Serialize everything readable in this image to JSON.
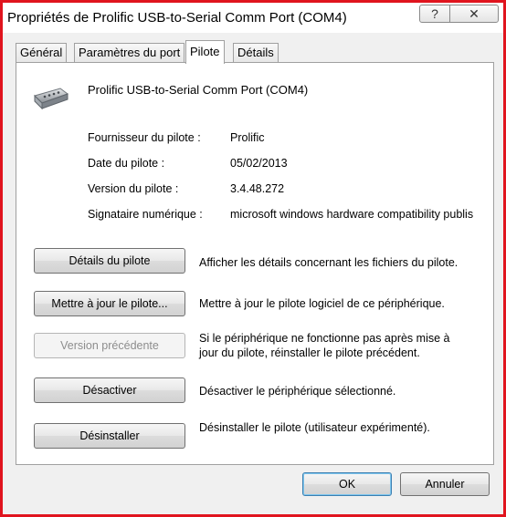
{
  "window": {
    "title": "Propriétés de Prolific USB-to-Serial Comm Port (COM4)",
    "help_label": "?",
    "close_label": "✕"
  },
  "tabs": [
    {
      "label": "Général"
    },
    {
      "label": "Paramètres du port"
    },
    {
      "label": "Pilote",
      "active": true
    },
    {
      "label": "Détails"
    }
  ],
  "device": {
    "icon": "serial-port-icon",
    "name": "Prolific USB-to-Serial Comm Port (COM4)"
  },
  "driver_info": [
    {
      "label": "Fournisseur du pilote :",
      "value": "Prolific"
    },
    {
      "label": "Date du pilote :",
      "value": "05/02/2013"
    },
    {
      "label": "Version du pilote :",
      "value": "3.4.48.272"
    },
    {
      "label": "Signataire numérique :",
      "value": "microsoft windows hardware compatibility publis"
    }
  ],
  "actions": [
    {
      "label": "Détails du pilote",
      "desc": [
        "Afficher les détails concernant les fichiers du pilote."
      ],
      "enabled": true
    },
    {
      "label": "Mettre à jour le pilote...",
      "desc": [
        "Mettre à jour le pilote logiciel de ce périphérique."
      ],
      "enabled": true
    },
    {
      "label": "Version précédente",
      "desc": [
        "Si le périphérique ne fonctionne pas après mise à",
        "jour du pilote, réinstaller le pilote précédent."
      ],
      "enabled": false
    },
    {
      "label": "Désactiver",
      "desc": [
        "Désactiver le périphérique sélectionné."
      ],
      "enabled": true
    },
    {
      "label": "Désinstaller",
      "desc": [
        "Désinstaller le pilote (utilisateur expérimenté)."
      ],
      "enabled": true
    }
  ],
  "footer": {
    "ok_label": "OK",
    "cancel_label": "Annuler"
  },
  "colors": {
    "frame_border": "#e0141e",
    "dialog_bg": "#f0f0f0"
  }
}
